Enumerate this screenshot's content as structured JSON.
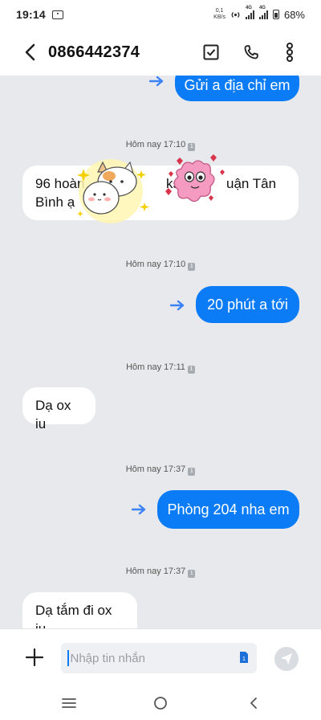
{
  "status_bar": {
    "time": "19:14",
    "net_speed_top": "0,1",
    "net_speed_bottom": "KB/s",
    "sim1_label": "4G",
    "sim2_label": "4G",
    "battery": "68%"
  },
  "header": {
    "phone_number": "0866442374"
  },
  "messages": [
    {
      "direction": "out",
      "text": "Gửi a địa chỉ em"
    },
    {
      "timestamp": "Hôm nay 17:10"
    },
    {
      "direction": "in",
      "text": "96 hoàng ks quận Tân Bình ạ",
      "line1_a": "96 hoàn",
      "line1_b": "ks",
      "line1_c": "uận Tân",
      "line2": "Bình ạ"
    },
    {
      "timestamp": "Hôm nay 17:10"
    },
    {
      "direction": "out",
      "text": "20 phút a tới"
    },
    {
      "timestamp": "Hôm nay 17:11"
    },
    {
      "direction": "in",
      "text": "Dạ ox iu"
    },
    {
      "timestamp": "Hôm nay 17:37"
    },
    {
      "direction": "out",
      "text": "Phòng 204 nha em"
    },
    {
      "timestamp": "Hôm nay 17:37"
    },
    {
      "direction": "in",
      "text": "Dạ tắm đi ox iu"
    }
  ],
  "timestamp_badge": "1",
  "composer": {
    "placeholder": "Nhập tin nhắn",
    "sim_badge": "1"
  },
  "colors": {
    "outgoing_bubble": "#0b7cf5",
    "incoming_bubble": "#ffffff",
    "chat_background": "#e8e9ec",
    "forward_arrow": "#3b82f6"
  }
}
